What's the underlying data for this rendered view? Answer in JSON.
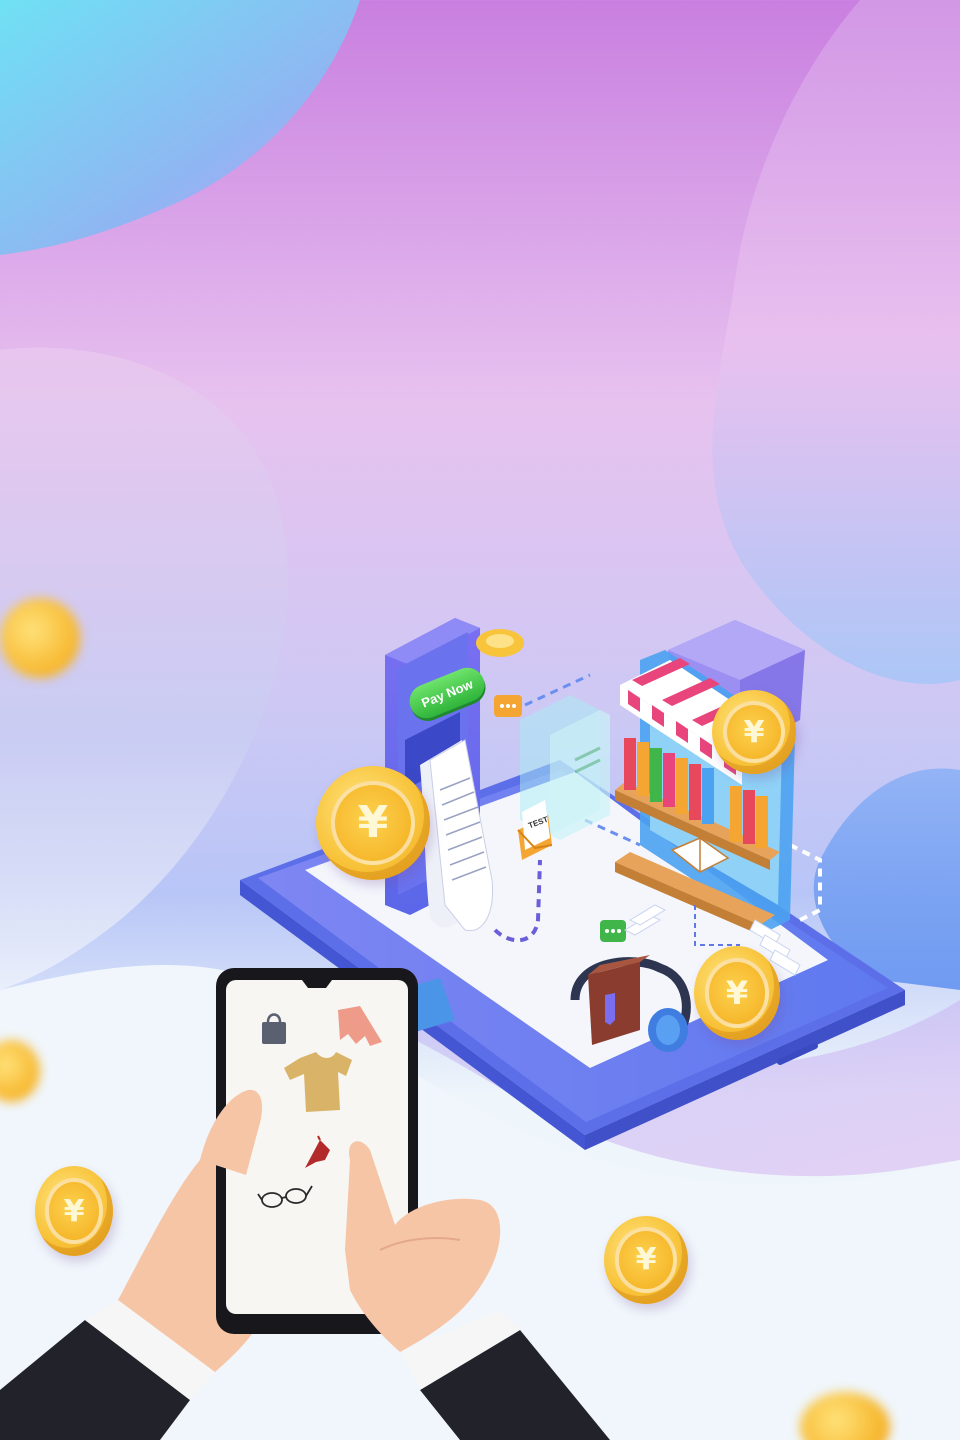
{
  "scene": {
    "pay_button_label": "Pay Now",
    "envelope_label": "TEST",
    "coin_symbol": "¥"
  },
  "colors": {
    "accent_purple": "#7a6df0",
    "coin_gold": "#f8c43b",
    "button_green": "#2fb43a",
    "awning_pink": "#e8457c"
  }
}
